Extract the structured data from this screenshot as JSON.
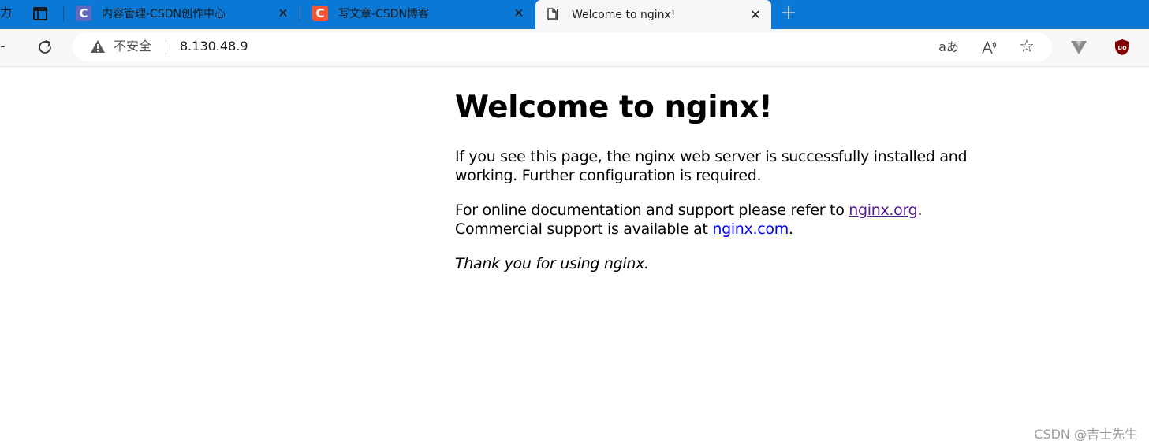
{
  "tabs": {
    "partial_label": "力",
    "items": [
      {
        "title": "内容管理-CSDN创作中心",
        "favicon_letter": "C",
        "favicon_color": "#5c6bc0",
        "active": false
      },
      {
        "title": "写文章-CSDN博客",
        "favicon_letter": "C",
        "favicon_color": "#fc5531",
        "active": false
      },
      {
        "title": "Welcome to nginx!",
        "favicon_letter": "",
        "favicon_color": "",
        "active": true
      }
    ],
    "close_glyph": "✕",
    "new_tab_glyph": "+"
  },
  "toolbar": {
    "back_glyph": "-",
    "security_label": "不安全",
    "url": "8.130.48.9",
    "translate_glyph": "aあ",
    "read_aloud_glyph": "A⁾",
    "favorite_glyph": "☆"
  },
  "page": {
    "heading": "Welcome to nginx!",
    "para1": "If you see this page, the nginx web server is successfully installed and working. Further configuration is required.",
    "para2_prefix": "For online documentation and support please refer to ",
    "para2_link": "nginx.org",
    "para2_mid": ".",
    "para2_line2_prefix": "Commercial support is available at ",
    "para2_link2": "nginx.com",
    "para2_suffix": ".",
    "para3": "Thank you for using nginx."
  },
  "watermark": "CSDN @吉士先生",
  "colors": {
    "tabstrip": "#0a78d4",
    "toolbar": "#f7f7f7",
    "visited_link": "#551a8b",
    "link": "#0000ee"
  }
}
